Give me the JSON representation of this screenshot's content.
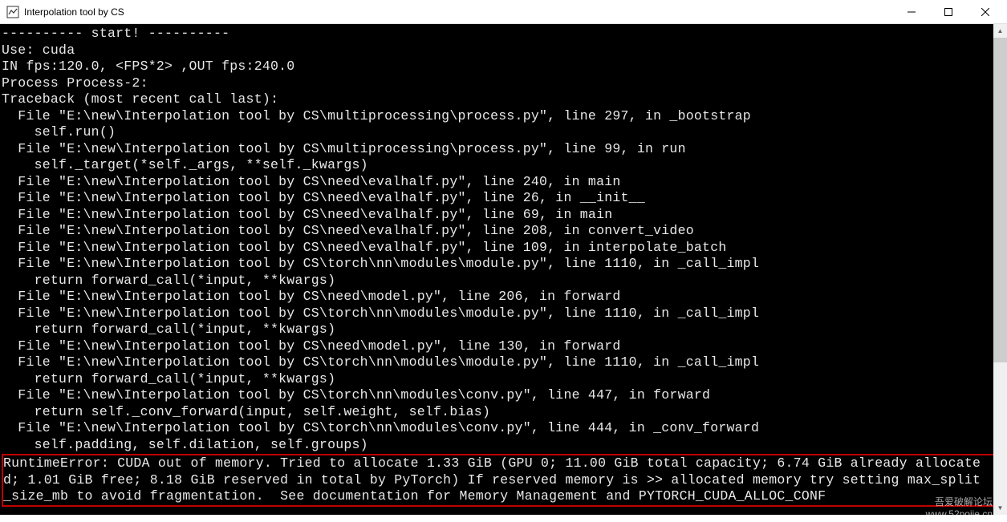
{
  "window": {
    "title": "Interpolation tool by CS"
  },
  "console": {
    "banner": "---------- start! ----------",
    "device": "Use: cuda",
    "fps_line": "IN fps:120.0, <FPS*2> ,OUT fps:240.0",
    "process": "Process Process-2:",
    "traceback_header": "Traceback (most recent call last):",
    "frames": [
      {
        "loc": "  File \"E:\\new\\Interpolation tool by CS\\multiprocessing\\process.py\", line 297, in _bootstrap",
        "code": "    self.run()"
      },
      {
        "loc": "  File \"E:\\new\\Interpolation tool by CS\\multiprocessing\\process.py\", line 99, in run",
        "code": "    self._target(*self._args, **self._kwargs)"
      },
      {
        "loc": "  File \"E:\\new\\Interpolation tool by CS\\need\\evalhalf.py\", line 240, in main",
        "code": ""
      },
      {
        "loc": "  File \"E:\\new\\Interpolation tool by CS\\need\\evalhalf.py\", line 26, in __init__",
        "code": ""
      },
      {
        "loc": "  File \"E:\\new\\Interpolation tool by CS\\need\\evalhalf.py\", line 69, in main",
        "code": ""
      },
      {
        "loc": "  File \"E:\\new\\Interpolation tool by CS\\need\\evalhalf.py\", line 208, in convert_video",
        "code": ""
      },
      {
        "loc": "  File \"E:\\new\\Interpolation tool by CS\\need\\evalhalf.py\", line 109, in interpolate_batch",
        "code": ""
      },
      {
        "loc": "  File \"E:\\new\\Interpolation tool by CS\\torch\\nn\\modules\\module.py\", line 1110, in _call_impl",
        "code": "    return forward_call(*input, **kwargs)"
      },
      {
        "loc": "  File \"E:\\new\\Interpolation tool by CS\\need\\model.py\", line 206, in forward",
        "code": ""
      },
      {
        "loc": "  File \"E:\\new\\Interpolation tool by CS\\torch\\nn\\modules\\module.py\", line 1110, in _call_impl",
        "code": "    return forward_call(*input, **kwargs)"
      },
      {
        "loc": "  File \"E:\\new\\Interpolation tool by CS\\need\\model.py\", line 130, in forward",
        "code": ""
      },
      {
        "loc": "  File \"E:\\new\\Interpolation tool by CS\\torch\\nn\\modules\\module.py\", line 1110, in _call_impl",
        "code": "    return forward_call(*input, **kwargs)"
      },
      {
        "loc": "  File \"E:\\new\\Interpolation tool by CS\\torch\\nn\\modules\\conv.py\", line 447, in forward",
        "code": "    return self._conv_forward(input, self.weight, self.bias)"
      },
      {
        "loc": "  File \"E:\\new\\Interpolation tool by CS\\torch\\nn\\modules\\conv.py\", line 444, in _conv_forward",
        "code": "    self.padding, self.dilation, self.groups)"
      }
    ],
    "error": "RuntimeError: CUDA out of memory. Tried to allocate 1.33 GiB (GPU 0; 11.00 GiB total capacity; 6.74 GiB already allocate\nd; 1.01 GiB free; 8.18 GiB reserved in total by PyTorch) If reserved memory is >> allocated memory try setting max_split\n_size_mb to avoid fragmentation.  See documentation for Memory Management and PYTORCH_CUDA_ALLOC_CONF"
  },
  "watermark": {
    "line1": "吾爱破解论坛",
    "line2": "www.52pojie.cn"
  }
}
